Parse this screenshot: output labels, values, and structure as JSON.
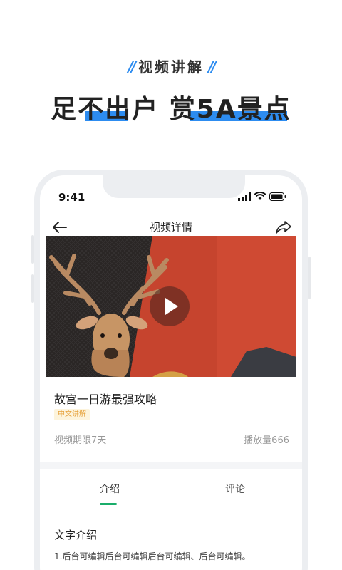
{
  "promo": {
    "eyebrow": "视频讲解",
    "headline": "足不出户 赏5A景点",
    "accent": "#2d8cf0"
  },
  "status_bar": {
    "time": "9:41"
  },
  "nav": {
    "title": "视频详情",
    "back_icon": "arrow-left-icon",
    "share_icon": "share-icon"
  },
  "video": {
    "play_icon": "play-icon"
  },
  "info": {
    "title": "故宫一日游最强攻略",
    "tag": "中文讲解",
    "period": "视频期限7天",
    "plays": "播放量666"
  },
  "tabs": [
    {
      "label": "介绍",
      "active": true
    },
    {
      "label": "评论",
      "active": false
    }
  ],
  "intro": {
    "heading": "文字介绍",
    "body": "1.后台可编辑后台可编辑后台可编辑、后台可编辑。"
  },
  "colors": {
    "tab_active": "#1aad6a",
    "tag_text": "#e6a23c",
    "tag_bg": "#fdf4dc",
    "video_bg": "#c6442e"
  }
}
